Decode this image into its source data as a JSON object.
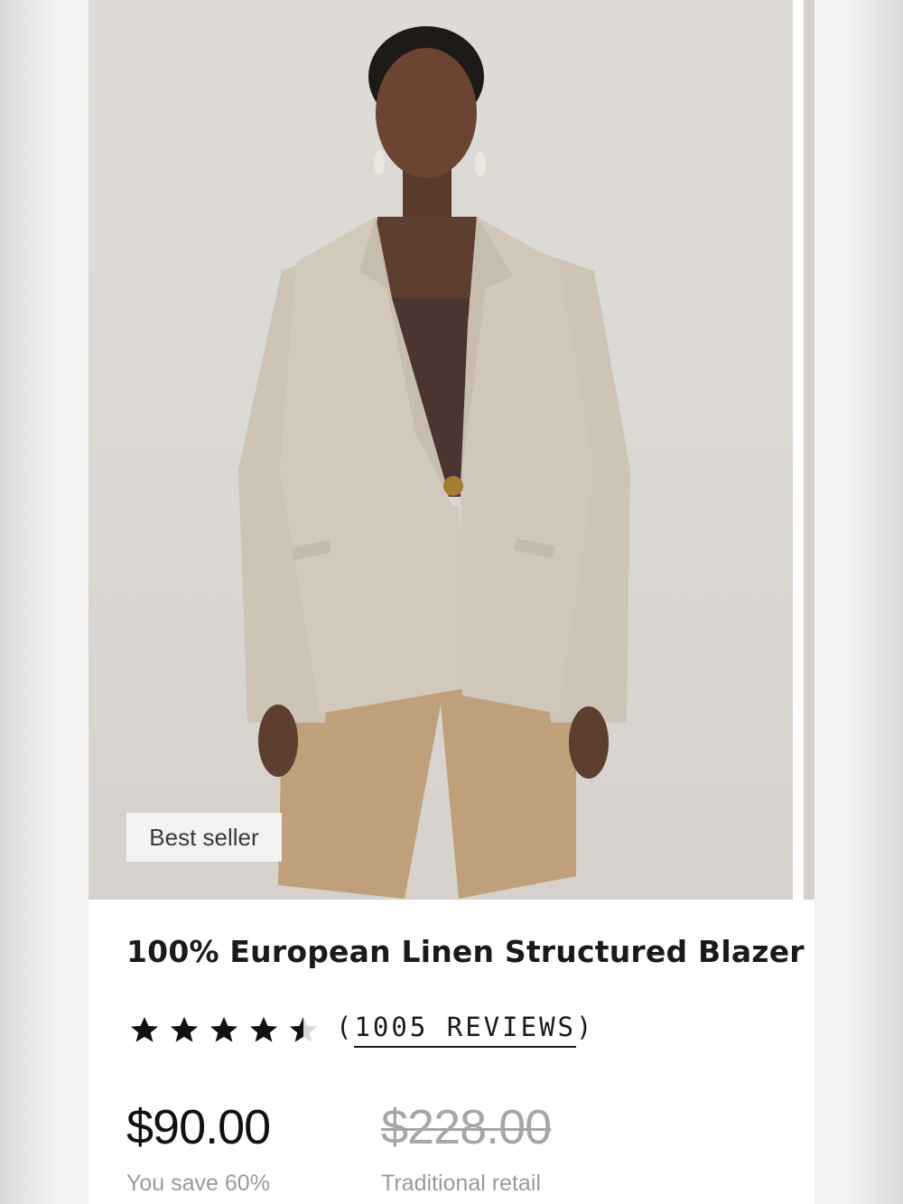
{
  "product": {
    "badge": "Best seller",
    "title": "100% European Linen Structured Blazer",
    "rating": 4.5,
    "rating_max": 5,
    "reviews_open": "(",
    "reviews_text": "1005 REVIEWS",
    "reviews_close": ")",
    "price": "$90.00",
    "savings_note": "You save 60%",
    "original_price": "$228.00",
    "original_price_note": "Traditional retail"
  },
  "colors": {
    "star": "#111111",
    "blazer": "#cfc6ba",
    "top": "#4a3530",
    "shorts": "#bfa07a"
  }
}
